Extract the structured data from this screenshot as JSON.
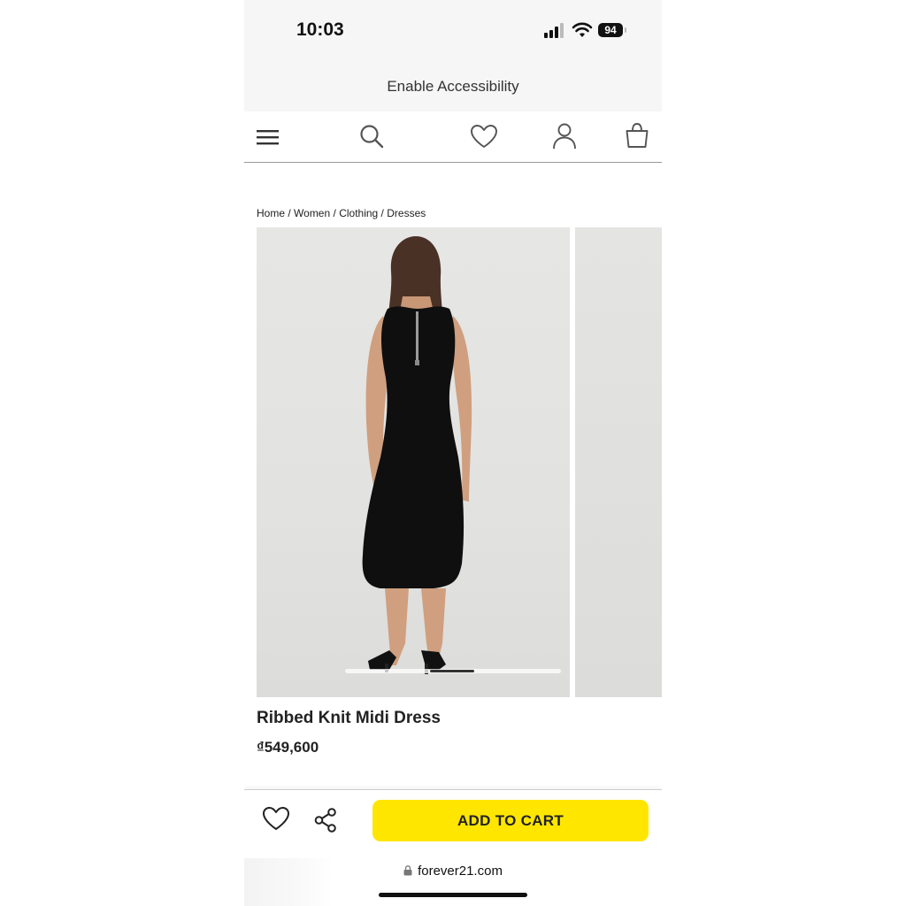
{
  "status_bar": {
    "time": "10:03",
    "battery": "94"
  },
  "accessibility": {
    "label": "Enable Accessibility"
  },
  "header": {
    "icons": [
      "menu-icon",
      "search-icon",
      "heart-icon",
      "user-icon",
      "shopping-bag-icon"
    ]
  },
  "breadcrumb": {
    "items": [
      "Home",
      "Women",
      "Clothing",
      "Dresses"
    ],
    "separator": " / "
  },
  "gallery": {
    "image_alt": "Ribbed Knit Midi Dress - back view",
    "scroll_position": 0.4
  },
  "product": {
    "title": "Ribbed Knit Midi Dress",
    "price": "₫549,600"
  },
  "actions": {
    "add_to_cart_label": "ADD TO CART",
    "wishlist_icon": "heart-outline-icon",
    "share_icon": "share-icon",
    "button_color": "#ffe600"
  },
  "browser": {
    "url": "forever21.com"
  }
}
